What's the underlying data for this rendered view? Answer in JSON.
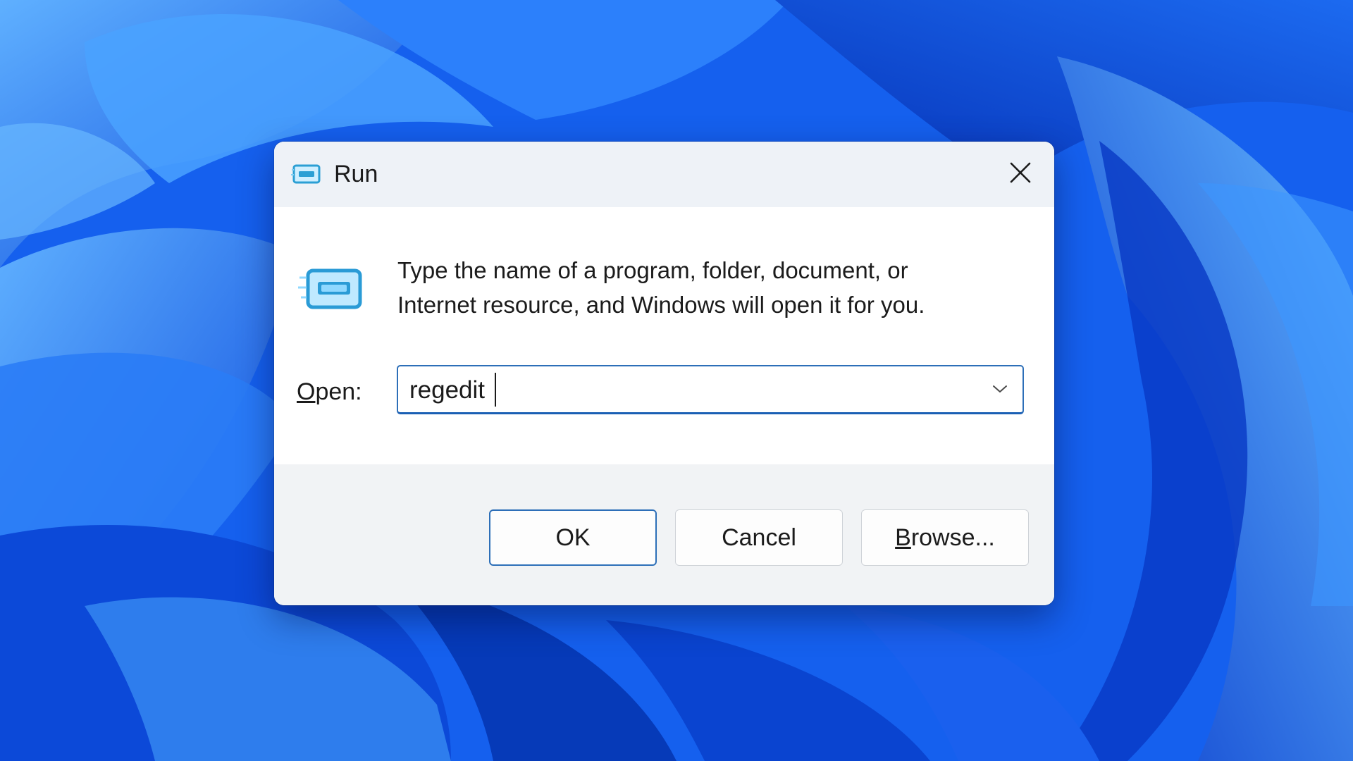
{
  "dialog": {
    "title": "Run",
    "close_icon": "close-icon",
    "app_icon": "run-icon",
    "description": "Type the name of a program, folder, document, or Internet resource, and Windows will open it for you.",
    "description_line1": "Type the name of a program, folder, document, or",
    "description_line2": "Internet resource, and Windows will open it for you.",
    "open_label_accel": "O",
    "open_label_rest": "pen:",
    "open_value": "regedit",
    "dropdown_icon": "chevron-down-icon",
    "buttons": {
      "ok": "OK",
      "cancel": "Cancel",
      "browse_accel": "B",
      "browse_rest": "rowse..."
    }
  },
  "colors": {
    "accent": "#2d6fb8",
    "titlebar": "#eef2f7",
    "footer": "#f1f3f5",
    "wallpaper": "#0a4fe6"
  }
}
